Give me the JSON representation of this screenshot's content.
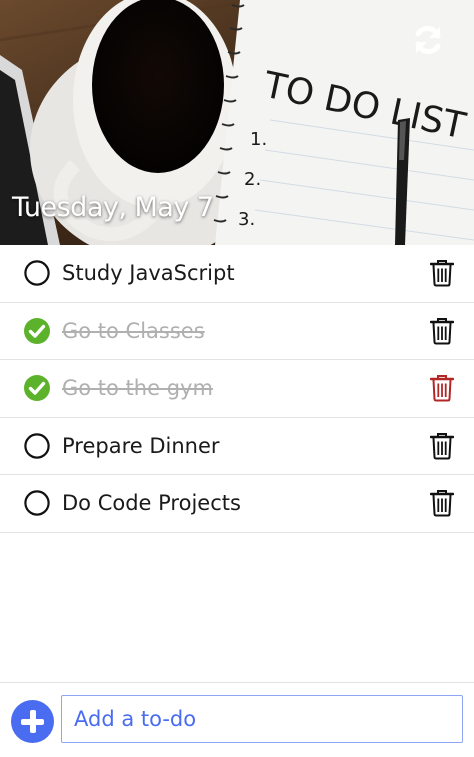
{
  "header": {
    "date": "Tuesday, May 7",
    "image_description": "coffee cup and TO DO LIST notepad",
    "notepad_title": "TO DO LIST",
    "notepad_numbers": [
      "1.",
      "2.",
      "3."
    ],
    "refresh_icon": "refresh-icon"
  },
  "colors": {
    "accent": "#4a6cf0",
    "done": "#5cb32b",
    "delete_active": "#b32626",
    "text": "#1a1a1a",
    "done_text": "#b0b0b0"
  },
  "todos": [
    {
      "label": "Study JavaScript",
      "done": false,
      "delete_highlighted": false
    },
    {
      "label": "Go to Classes",
      "done": true,
      "delete_highlighted": false
    },
    {
      "label": "Go to the gym",
      "done": true,
      "delete_highlighted": true
    },
    {
      "label": "Prepare Dinner",
      "done": false,
      "delete_highlighted": false
    },
    {
      "label": "Do Code Projects",
      "done": false,
      "delete_highlighted": false
    }
  ],
  "footer": {
    "add_placeholder": "Add a to-do",
    "add_icon": "plus-icon"
  }
}
